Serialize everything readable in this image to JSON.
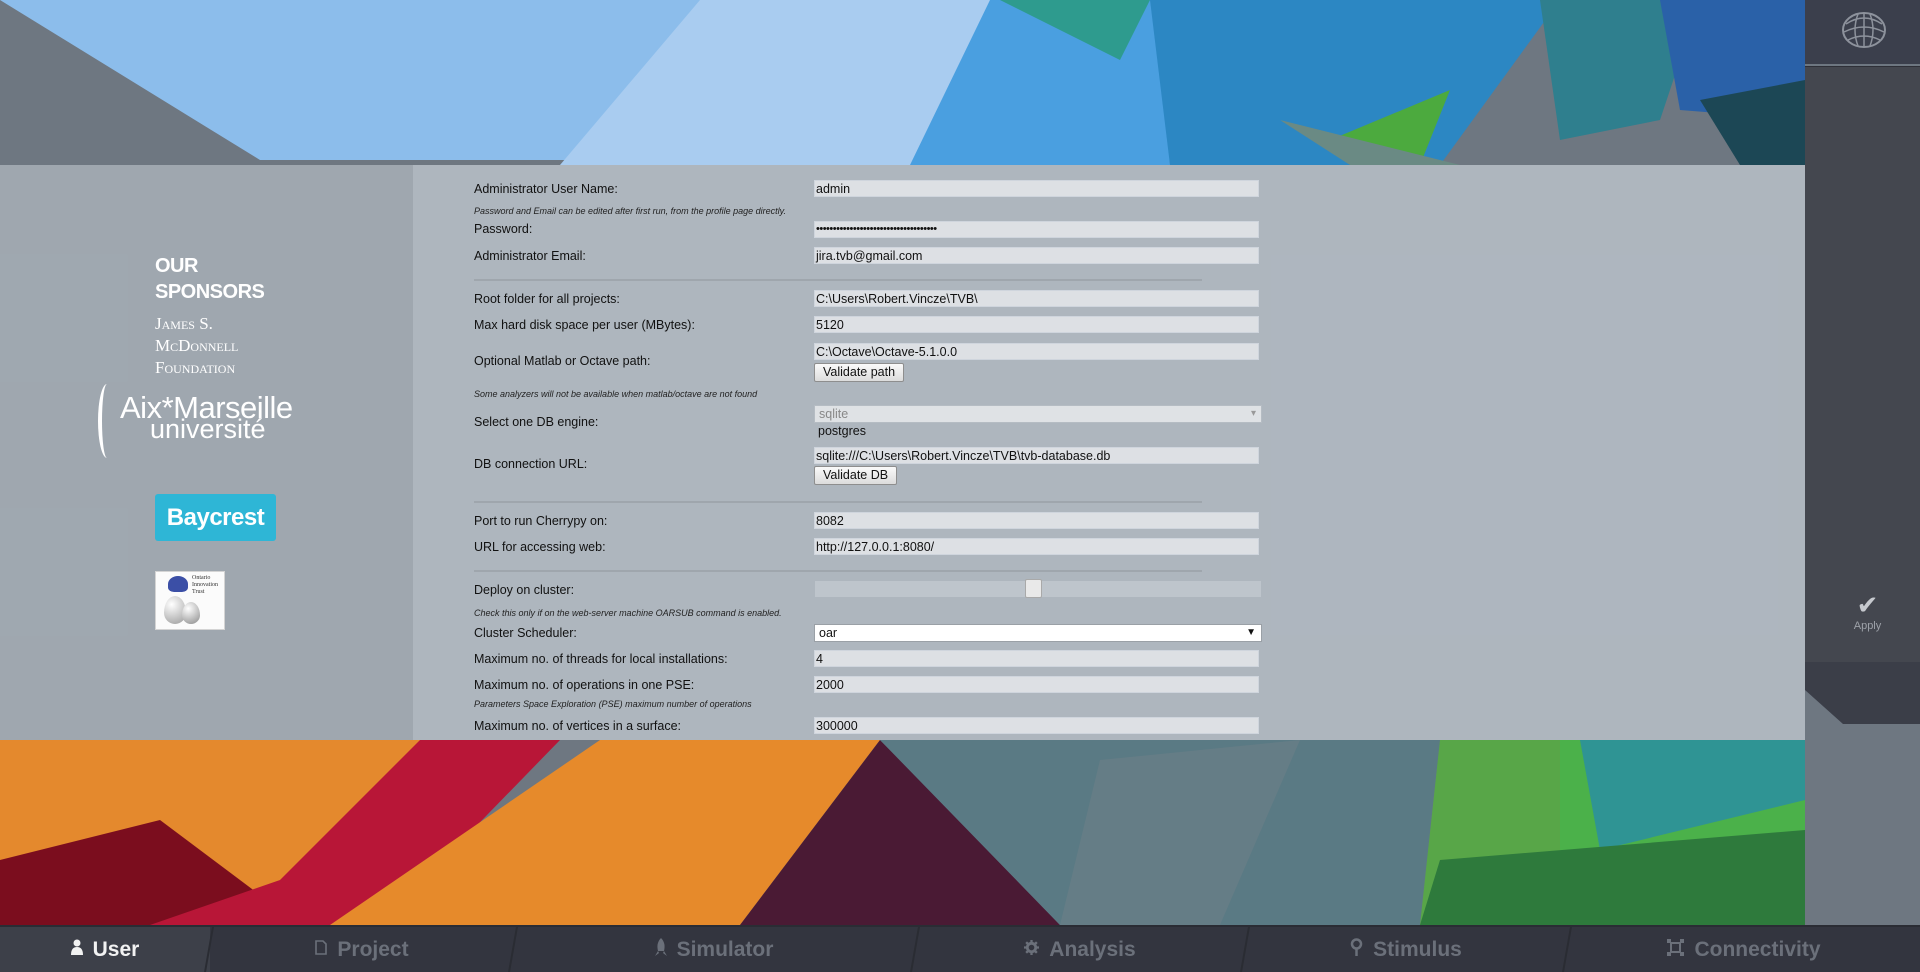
{
  "colors": {
    "accent": "#2eb6d6",
    "nav_active_text": "#f2f2f2",
    "nav_inactive_text": "#6b707a"
  },
  "sponsors": {
    "title_line1": "OUR",
    "title_line2": "SPONSORS",
    "jsm_line1": "James S.",
    "jsm_line2": "McDonnell",
    "jsm_line3": "Foundation",
    "amu_line1": "Aix*Marseille",
    "amu_line2": "université",
    "baycrest": "Baycrest",
    "oit_line1": "Ontario",
    "oit_line2": "Innovation",
    "oit_line3": "Trust"
  },
  "form": {
    "admin_username": {
      "label": "Administrator User Name:",
      "value": "admin"
    },
    "hint_password": "Password and Email can be edited after first run, from the profile page directly.",
    "password": {
      "label": "Password:",
      "value": "••••••••••••••••••••••••••••••••••••"
    },
    "admin_email": {
      "label": "Administrator Email:",
      "value": "jira.tvb@gmail.com"
    },
    "root_folder": {
      "label": "Root folder for all projects:",
      "value": "C:\\Users\\Robert.Vincze\\TVB\\"
    },
    "max_disk": {
      "label": "Max hard disk space per user (MBytes):",
      "value": "5120"
    },
    "matlab_path": {
      "label": "Optional Matlab or Octave path:",
      "value": "C:\\Octave\\Octave-5.1.0.0",
      "button": "Validate path"
    },
    "hint_matlab": "Some analyzers will not be available when matlab/octave are not found",
    "db_engine": {
      "label": "Select one DB engine:",
      "selected": "sqlite",
      "option2": "postgres",
      "arrow": "▾"
    },
    "db_url": {
      "label": "DB connection URL:",
      "value": "sqlite:///C:\\Users\\Robert.Vincze\\TVB\\tvb-database.db",
      "button": "Validate DB"
    },
    "cherrypy_port": {
      "label": "Port to run Cherrypy on:",
      "value": "8082"
    },
    "web_url": {
      "label": "URL for accessing web:",
      "value": "http://127.0.0.1:8080/"
    },
    "deploy_cluster": {
      "label": "Deploy on cluster:",
      "slider_level": 0.49
    },
    "hint_cluster": "Check this only if on the web-server machine OARSUB command is enabled.",
    "cluster_scheduler": {
      "label": "Cluster Scheduler:",
      "value": "oar",
      "arrow": "▼"
    },
    "max_threads": {
      "label": "Maximum no. of threads for local installations:",
      "value": "4"
    },
    "max_operations": {
      "label": "Maximum no. of operations in one PSE:",
      "value": "2000"
    },
    "hint_pse": "Parameters Space Exploration (PSE) maximum number of operations",
    "max_vertices": {
      "label": "Maximum no. of vertices in a surface:",
      "value": "300000"
    }
  },
  "sidebar": {
    "apply_label": "Apply",
    "apply_icon": "check-icon",
    "logo_icon": "brain-icon"
  },
  "nav": {
    "tabs": [
      {
        "label": "User",
        "icon": "user-icon",
        "active": true
      },
      {
        "label": "Project",
        "icon": "document-icon",
        "active": false
      },
      {
        "label": "Simulator",
        "icon": "rocket-icon",
        "active": false
      },
      {
        "label": "Analysis",
        "icon": "gear-icon",
        "active": false
      },
      {
        "label": "Stimulus",
        "icon": "pin-icon",
        "active": false
      },
      {
        "label": "Connectivity",
        "icon": "network-icon",
        "active": false
      }
    ]
  }
}
